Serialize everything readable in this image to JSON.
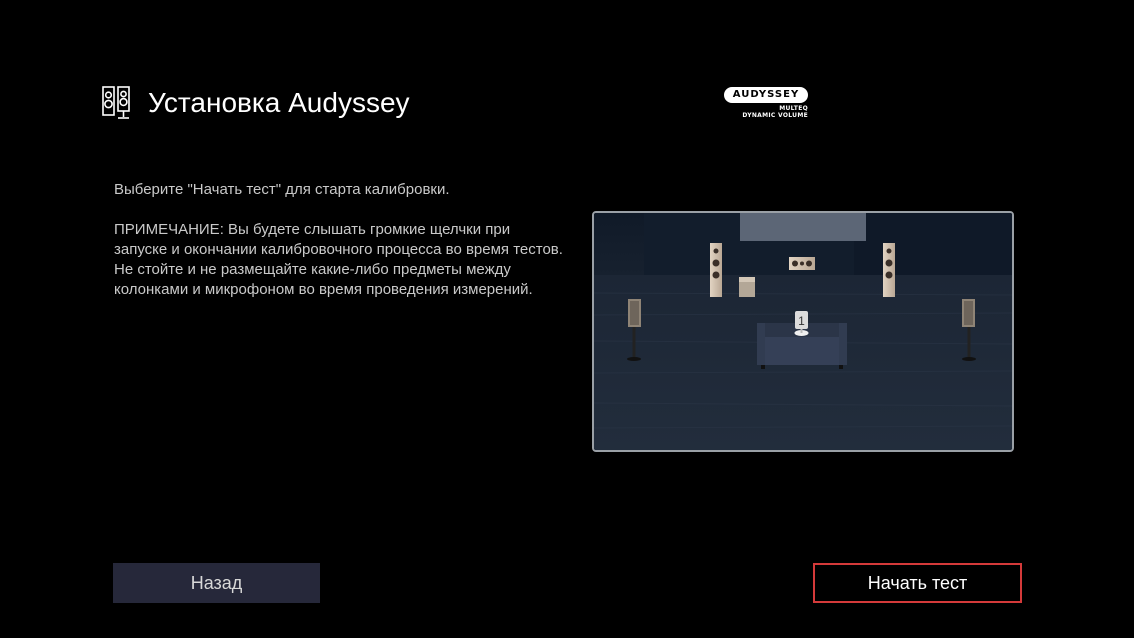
{
  "header": {
    "icon": "speakers-icon",
    "title": "Установка Audyssey"
  },
  "logo": {
    "brand": "AUDYSSEY",
    "line1": "MULTEQ",
    "line2": "DYNAMIC VOLUME"
  },
  "instructions": {
    "line1": "Выберите \"Начать тест\" для старта калибровки.",
    "note": "ПРИМЕЧАНИЕ: Вы будете слышать громкие щелчки при запуске и окончании калибровочного процесса во время тестов.",
    "warning": "Не стойте и не размещайте какие-либо предметы между колонками и микрофоном во время проведения измерений."
  },
  "room": {
    "mic_position_label": "1"
  },
  "buttons": {
    "back_label": "Назад",
    "start_label": "Начать тест"
  },
  "colors": {
    "background": "#000000",
    "back_button": "#26283a",
    "start_button_border": "#d43a3a",
    "speaker_wood": "#cdbba9",
    "room_floor": "#1a2535"
  }
}
